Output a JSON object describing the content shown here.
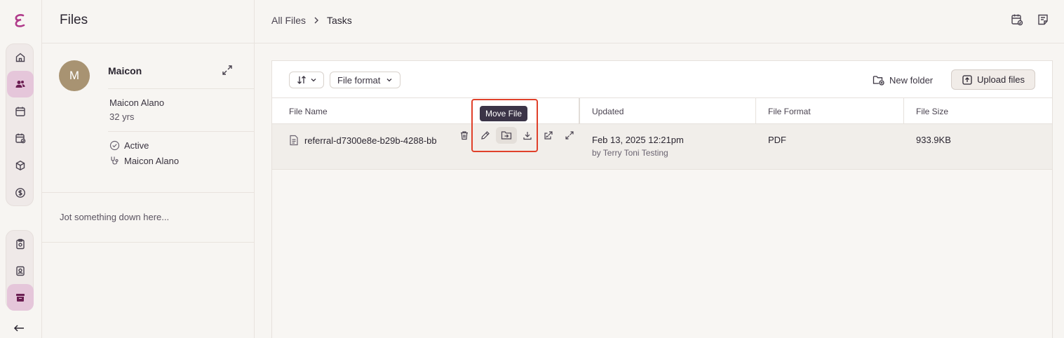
{
  "sidebar_nav": {
    "items": [
      "home-icon",
      "users-icon",
      "calendar-icon",
      "calendar-check-icon",
      "cube-icon",
      "dollar-icon"
    ],
    "lower_items": [
      "clipboard-icon",
      "badge-icon",
      "archive-icon"
    ],
    "active": "users-icon",
    "back_label": "←"
  },
  "panel": {
    "title": "Files",
    "patient": {
      "initial": "M",
      "name": "Maicon",
      "full_name": "Maicon Alano",
      "age": "32 yrs",
      "status": "Active",
      "provider": "Maicon Alano"
    },
    "notes_placeholder": "Jot something down here..."
  },
  "breadcrumb": {
    "root": "All Files",
    "separator": "›",
    "current": "Tasks"
  },
  "toolbar": {
    "sort_label": "↓↑",
    "format_filter": "File format",
    "new_folder": "New folder",
    "upload": "Upload files"
  },
  "table": {
    "headers": [
      "File Name",
      "Updated",
      "File Format",
      "File Size"
    ],
    "rows": [
      {
        "file_name": "referral-d7300e8e-b29b-4288-bb",
        "updated": "Feb 13, 2025 12:21pm",
        "updated_by": "by Terry Toni Testing",
        "format": "PDF",
        "size": "933.9KB"
      }
    ]
  },
  "tooltip": "Move File",
  "colors": {
    "accent": "#6b1e52",
    "active_bg": "#e5c6da",
    "highlight": "#e0402a",
    "tooltip_bg": "#3b3447"
  }
}
